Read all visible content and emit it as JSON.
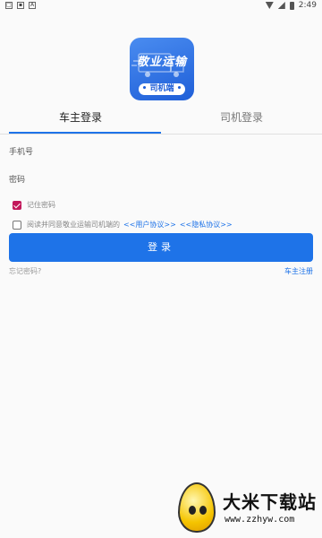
{
  "status_bar": {
    "time": "2:49",
    "icons": [
      "sim-icon",
      "shield-icon",
      "download-icon"
    ]
  },
  "logo": {
    "title": "敬业运输",
    "badge": "• 司机端 •",
    "accent": "#1f5fd8"
  },
  "tabs": [
    {
      "label": "车主登录",
      "active": true
    },
    {
      "label": "司机登录",
      "active": false
    }
  ],
  "form": {
    "phone_label": "手机号",
    "phone_value": "",
    "password_label": "密码",
    "password_value": "",
    "remember_label": "记住密码",
    "remember_checked": true,
    "agree_text": "阅读并同意敬业运输司机端的",
    "agree_checked": false,
    "user_agreement": "<<用户协议>>",
    "privacy_policy": "<<隐私协议>>",
    "login_button": "登录",
    "forgot_password": "忘记密码?",
    "owner_register": "车主注册"
  },
  "watermark": {
    "title": "大米下载站",
    "url": "www.zzhyw.com"
  },
  "colors": {
    "primary": "#1e73e8",
    "checkbox": "#c2185b"
  }
}
